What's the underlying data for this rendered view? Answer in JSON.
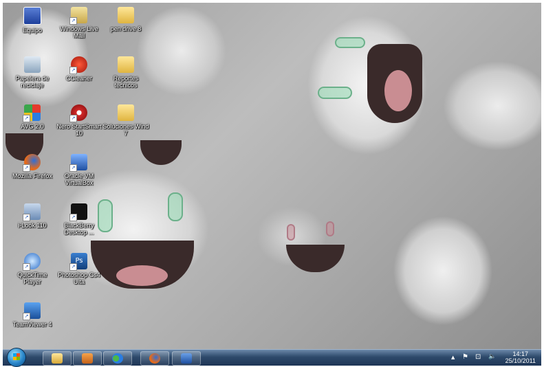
{
  "desktop": {
    "icons": [
      {
        "label": "Equipo"
      },
      {
        "label": "Windows Live Mail"
      },
      {
        "label": "pen drive 8"
      },
      {
        "label": "Papelera de reciclaje"
      },
      {
        "label": "CCleaner"
      },
      {
        "label": "Reportes tecnicos"
      },
      {
        "label": "AVG 2.0"
      },
      {
        "label": "Nero StartSmart 10"
      },
      {
        "label": "Soluciones Wind 7"
      },
      {
        "label": "Mozilla Firefox"
      },
      {
        "label": "Oracle VM VirtualBox"
      },
      {
        "label": "i-Look 110"
      },
      {
        "label": "BlackBerry Desktop ..."
      },
      {
        "label": "QuickTime Player"
      },
      {
        "label": "Photoshop Cs4 Ulta"
      },
      {
        "label": "TeamViewer 4"
      }
    ]
  },
  "taskbar": {
    "tray": {
      "arrow": "▲",
      "flag": "⚑",
      "network": "⊡",
      "volume": "🔈"
    },
    "clock": {
      "time": "14:17",
      "date": "25/10/2011"
    }
  }
}
